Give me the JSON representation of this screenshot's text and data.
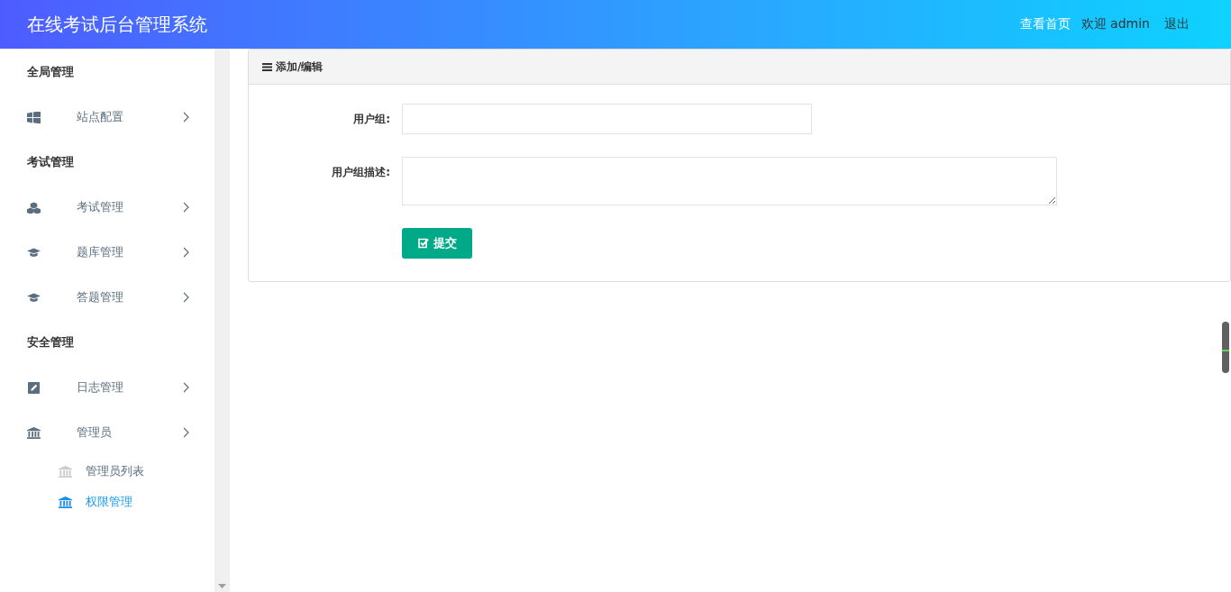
{
  "header": {
    "title": "在线考试后台管理系统",
    "links": [
      {
        "label": "查看首页",
        "kind": "link"
      },
      {
        "label": "欢迎 admin",
        "kind": "text"
      },
      {
        "label": "退出",
        "kind": "link"
      }
    ]
  },
  "sidebar": {
    "sections": [
      {
        "title": "全局管理",
        "items": [
          {
            "label": "站点配置",
            "kind": "windows"
          }
        ]
      },
      {
        "title": "考试管理",
        "items": [
          {
            "label": "考试管理",
            "kind": "cubes"
          },
          {
            "label": "题库管理",
            "kind": "cap"
          },
          {
            "label": "答题管理",
            "kind": "cap"
          }
        ]
      },
      {
        "title": "安全管理",
        "items": [
          {
            "label": "日志管理",
            "kind": "edit"
          },
          {
            "label": "管理员",
            "kind": "bank",
            "children": [
              {
                "label": "管理员列表",
                "selected": false
              },
              {
                "label": "权限管理",
                "selected": true
              }
            ]
          }
        ]
      }
    ]
  },
  "panel": {
    "title": "添加/编辑",
    "fields": [
      {
        "label": "用户组:",
        "kind": "input"
      },
      {
        "label": "用户组描述:",
        "kind": "textarea"
      }
    ],
    "submit": "提交"
  }
}
